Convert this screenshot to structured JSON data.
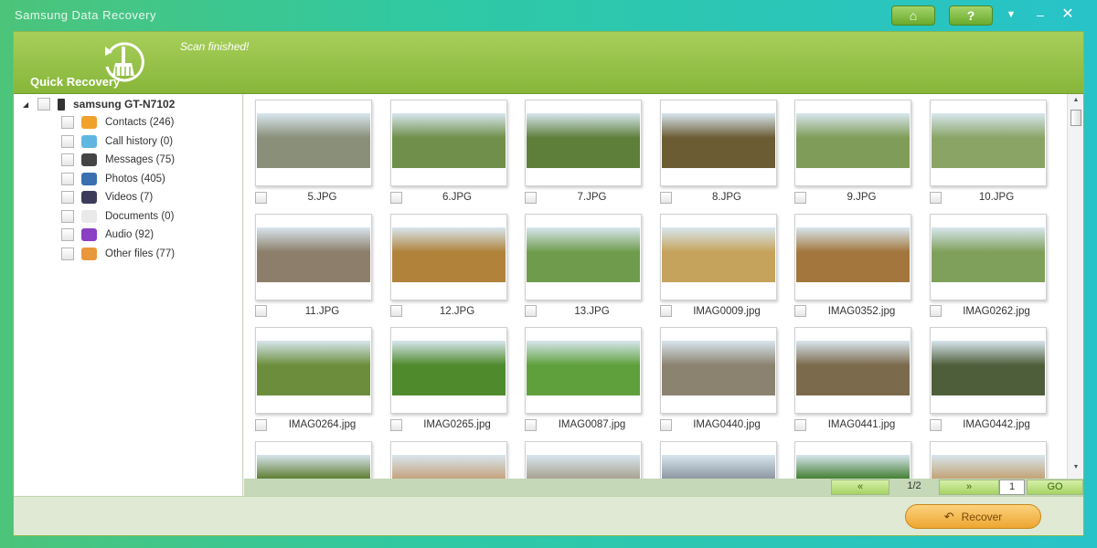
{
  "app": {
    "title": "Samsung Data Recovery",
    "home_icon": "⌂",
    "help_icon": "?",
    "dropdown_icon": "▼",
    "minimize_icon": "‒",
    "close_icon": "✕"
  },
  "header": {
    "quick_recovery_label": "Quick Recovery",
    "scan_status": "Scan finished!"
  },
  "sidebar": {
    "device_name": "samsung GT-N7102",
    "expander": "◢",
    "categories": [
      {
        "label": "Contacts (246)",
        "icon": "contacts-icon",
        "color": "#f0a12c"
      },
      {
        "label": "Call history (0)",
        "icon": "call-history-icon",
        "color": "#5fb6e0"
      },
      {
        "label": "Messages (75)",
        "icon": "messages-icon",
        "color": "#444444"
      },
      {
        "label": "Photos (405)",
        "icon": "photos-icon",
        "color": "#3a6fb0"
      },
      {
        "label": "Videos (7)",
        "icon": "videos-icon",
        "color": "#3c3c5a"
      },
      {
        "label": "Documents (0)",
        "icon": "documents-icon",
        "color": "#e9e9e9"
      },
      {
        "label": "Audio (92)",
        "icon": "audio-icon",
        "color": "#8a3fc4"
      },
      {
        "label": "Other files (77)",
        "icon": "other-files-icon",
        "color": "#e8973a"
      }
    ]
  },
  "photos": [
    {
      "name": "5.JPG",
      "bg": "#8a8f7a"
    },
    {
      "name": "6.JPG",
      "bg": "#6f8f4a"
    },
    {
      "name": "7.JPG",
      "bg": "#5e7f3a"
    },
    {
      "name": "8.JPG",
      "bg": "#6b5c34"
    },
    {
      "name": "9.JPG",
      "bg": "#7f9c58"
    },
    {
      "name": "10.JPG",
      "bg": "#8aa466"
    },
    {
      "name": "11.JPG",
      "bg": "#8c7e6a"
    },
    {
      "name": "12.JPG",
      "bg": "#b0823a"
    },
    {
      "name": "13.JPG",
      "bg": "#6f9c4c"
    },
    {
      "name": "IMAG0009.jpg",
      "bg": "#c6a35c"
    },
    {
      "name": "IMAG0352.jpg",
      "bg": "#a2763c"
    },
    {
      "name": "IMAG0262.jpg",
      "bg": "#7fa05a"
    },
    {
      "name": "IMAG0264.jpg",
      "bg": "#6c8e3c"
    },
    {
      "name": "IMAG0265.jpg",
      "bg": "#4f8a2c"
    },
    {
      "name": "IMAG0087.jpg",
      "bg": "#5fa03c"
    },
    {
      "name": "IMAG0440.jpg",
      "bg": "#8c8270"
    },
    {
      "name": "IMAG0441.jpg",
      "bg": "#7c6a4c"
    },
    {
      "name": "IMAG0442.jpg",
      "bg": "#4f5e3a"
    },
    {
      "name": "",
      "bg": "#5c7a2c"
    },
    {
      "name": "",
      "bg": "#c5a07a"
    },
    {
      "name": "",
      "bg": "#a6a08e"
    },
    {
      "name": "",
      "bg": "#8a94a0"
    },
    {
      "name": "",
      "bg": "#3f7c2c"
    },
    {
      "name": "",
      "bg": "#c2a070"
    }
  ],
  "scroll": {
    "up": "▲",
    "down": "▼"
  },
  "pager": {
    "first": "«",
    "status": "1/2",
    "next": "»",
    "page_input": "1",
    "go": "GO"
  },
  "footer": {
    "recover_icon": "↶",
    "recover_label": "Recover"
  }
}
